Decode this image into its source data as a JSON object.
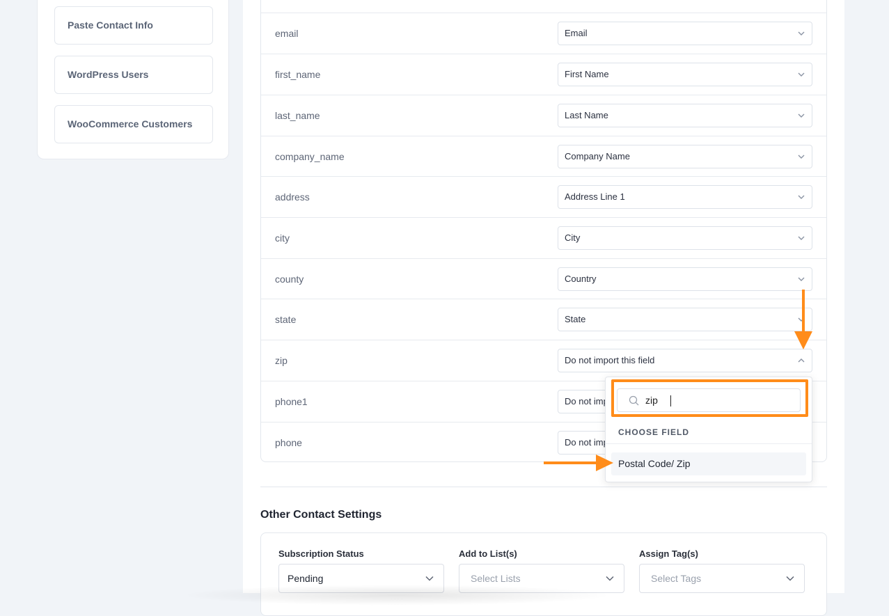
{
  "sidebar": {
    "items": [
      {
        "label": "Paste Contact Info"
      },
      {
        "label": "WordPress Users"
      },
      {
        "label": "WooCommerce Customers"
      }
    ]
  },
  "mapping": {
    "rows": [
      {
        "label": "email",
        "value": "Email"
      },
      {
        "label": "first_name",
        "value": "First Name"
      },
      {
        "label": "last_name",
        "value": "Last Name"
      },
      {
        "label": "company_name",
        "value": "Company Name"
      },
      {
        "label": "address",
        "value": "Address Line 1"
      },
      {
        "label": "city",
        "value": "City"
      },
      {
        "label": "county",
        "value": "Country"
      },
      {
        "label": "state",
        "value": "State"
      },
      {
        "label": "zip",
        "value": "Do not import this field"
      },
      {
        "label": "phone1",
        "value": "Do not import this field"
      },
      {
        "label": "phone",
        "value": "Do not import this field"
      }
    ]
  },
  "dropdown": {
    "search_value": "zip",
    "heading": "CHOOSE FIELD",
    "option": "Postal Code/ Zip"
  },
  "other_settings": {
    "title": "Other Contact Settings",
    "subscription_label": "Subscription Status",
    "subscription_value": "Pending",
    "lists_label": "Add to List(s)",
    "lists_placeholder": "Select Lists",
    "tags_label": "Assign Tag(s)",
    "tags_placeholder": "Select Tags"
  },
  "colors": {
    "annotation": "#ff8c1a"
  }
}
